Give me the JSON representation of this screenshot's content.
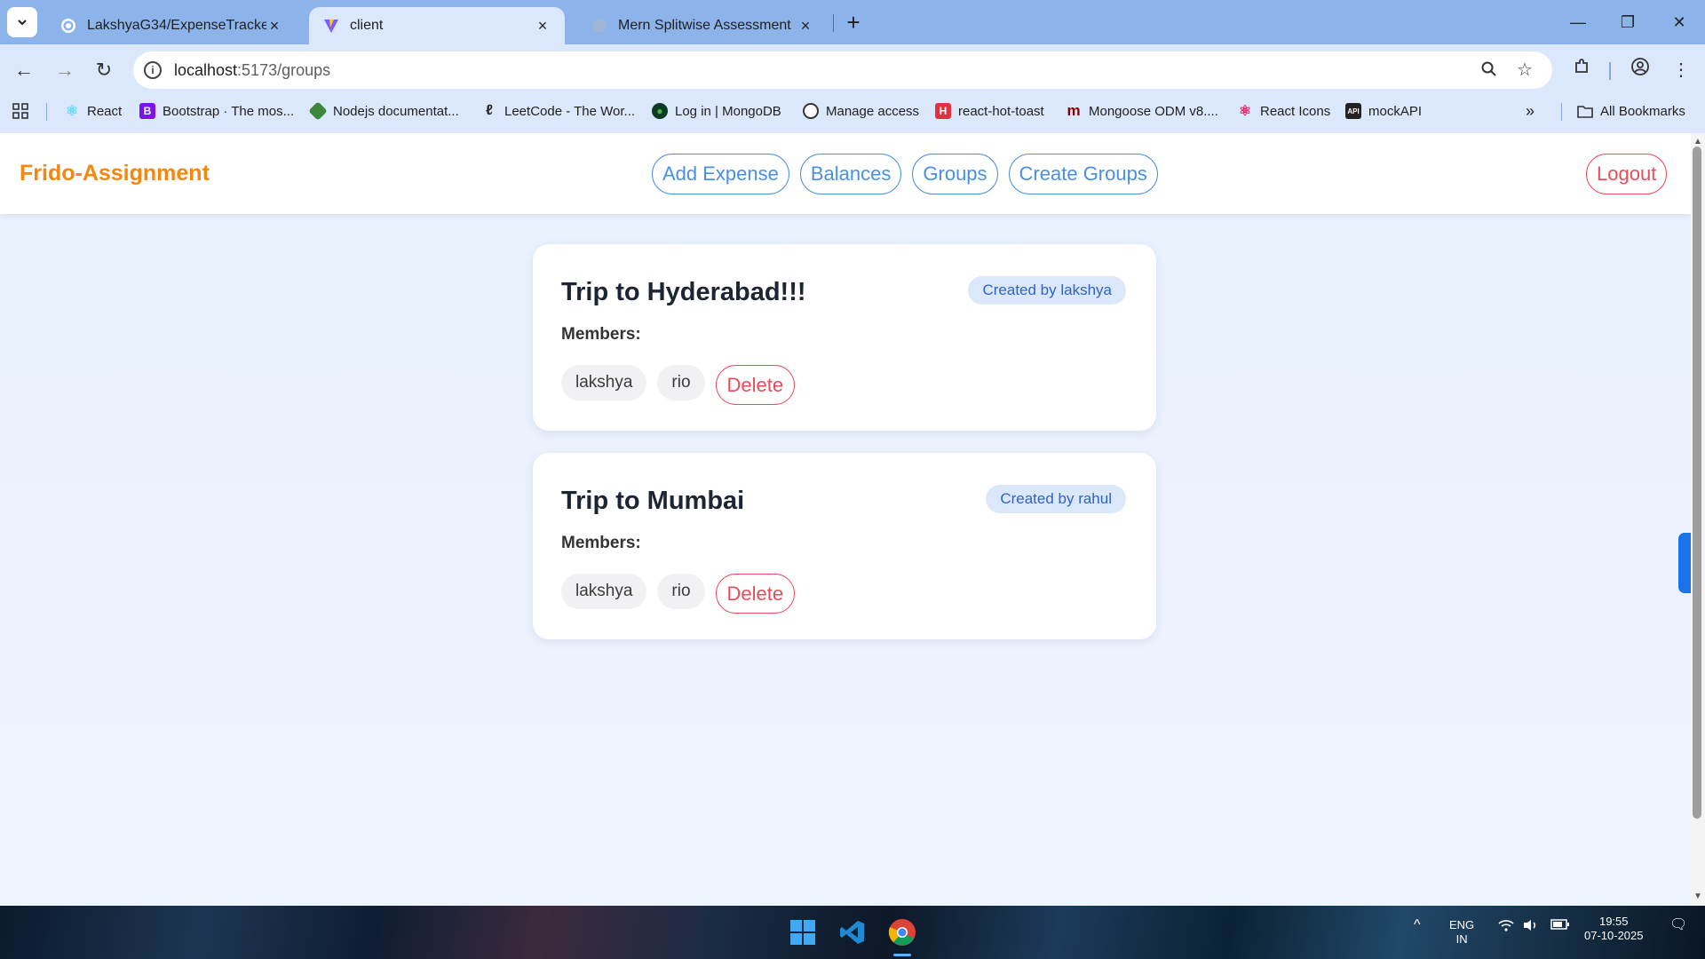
{
  "browser": {
    "tabs": [
      {
        "title": "LakshyaG34/ExpenseTracker-Fri",
        "icon": "github-icon",
        "active": false
      },
      {
        "title": "client",
        "icon": "vite-icon",
        "active": true
      },
      {
        "title": "Mern Splitwise Assessment",
        "icon": "globe-icon",
        "active": false
      }
    ],
    "address": {
      "host": "localhost",
      "path": ":5173/groups"
    },
    "bookmarks": [
      {
        "label": "React",
        "icon": "react-icon"
      },
      {
        "label": "Bootstrap · The mos...",
        "icon": "bootstrap-icon"
      },
      {
        "label": "Nodejs documentat...",
        "icon": "nodejs-icon"
      },
      {
        "label": "LeetCode - The Wor...",
        "icon": "leetcode-icon"
      },
      {
        "label": "Log in | MongoDB",
        "icon": "mongodb-icon"
      },
      {
        "label": "Manage access",
        "icon": "github-icon"
      },
      {
        "label": "react-hot-toast",
        "icon": "toast-icon"
      },
      {
        "label": "Mongoose ODM v8....",
        "icon": "mongoose-icon"
      },
      {
        "label": "React Icons",
        "icon": "react-icons-icon"
      },
      {
        "label": "mockAPI",
        "icon": "mockapi-icon"
      }
    ],
    "all_bookmarks": "All Bookmarks"
  },
  "app": {
    "brand": "Frido-Assignment",
    "nav": [
      "Add Expense",
      "Balances",
      "Groups",
      "Create Groups"
    ],
    "logout": "Logout",
    "members_label": "Members:",
    "delete_label": "Delete",
    "groups": [
      {
        "title": "Trip to Hyderabad!!!",
        "created_by": "Created by lakshya",
        "members": [
          "lakshya",
          "rio"
        ]
      },
      {
        "title": "Trip to Mumbai",
        "created_by": "Created by rahul",
        "members": [
          "lakshya",
          "rio"
        ]
      }
    ]
  },
  "taskbar": {
    "lang": "ENG",
    "region": "IN",
    "time": "19:55",
    "date": "07-10-2025"
  },
  "colors": {
    "brand": "#f5870f",
    "accent": "#4a90e2",
    "danger": "#ea4c5a"
  }
}
